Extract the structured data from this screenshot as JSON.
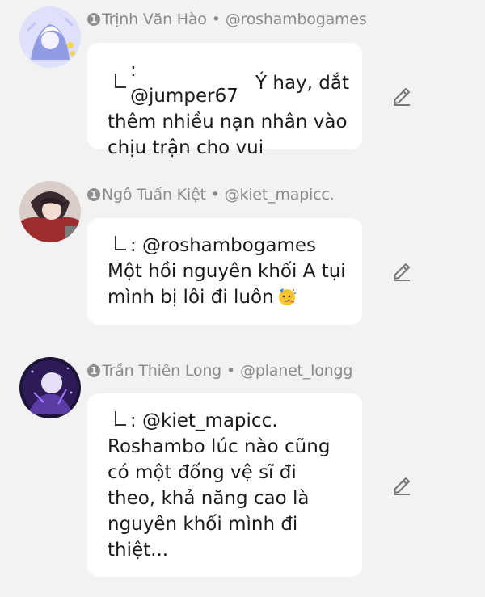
{
  "comments": [
    {
      "badge": "1",
      "name": "Trịnh Văn Hào",
      "separator": "•",
      "handle": "@roshambogames",
      "mention": ": @jumper67",
      "line1_rest": " Ý hay, dắt",
      "body": "thêm nhiều nạn nhân vào chịu trận cho vui",
      "avatar_color": "#9aa7e8"
    },
    {
      "badge": "1",
      "name": "Ngô Tuấn Kiệt",
      "separator": "•",
      "handle": "@kiet_mapicc.",
      "mention": ": @roshambogames",
      "line1_rest": "",
      "body": "Một hồi nguyên khối A tụi mình bị lôi đi luôn",
      "emoji": "party-face-emoji",
      "avatar_color": "#a23a3a"
    },
    {
      "badge": "1",
      "name": "Trần Thiên Long",
      "separator": "•",
      "handle": "@planet_longg",
      "mention": ": @kiet_mapicc.",
      "line1_rest": "",
      "body": "Roshambo lúc nào cũng có một đống vệ sĩ đi theo, khả năng cao là nguyên khối mình đi thiệt...",
      "avatar_color": "#4a2d8a"
    }
  ],
  "icons": {
    "edit": "pencil-icon",
    "reply": "reply-arrow-icon"
  }
}
